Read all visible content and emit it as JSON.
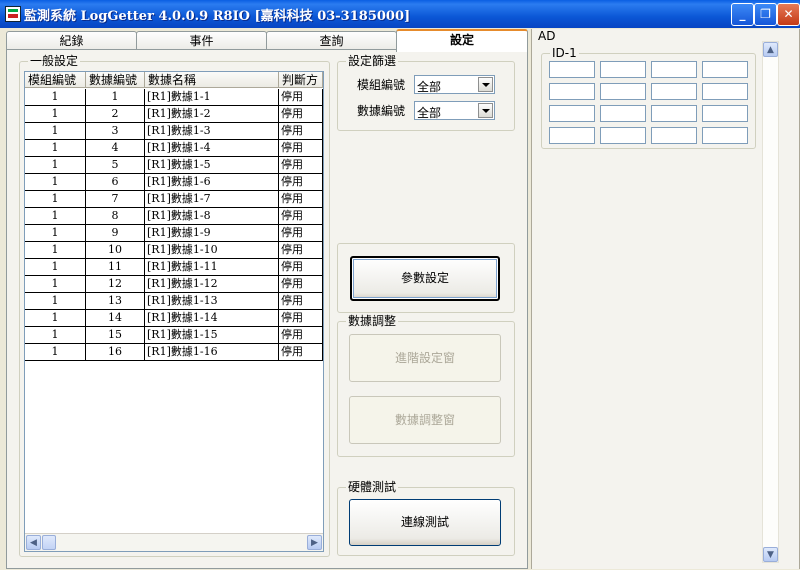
{
  "window": {
    "title": "監測系統 LogGetter 4.0.0.9 R8IO  [嘉科科技 03-3185000]",
    "minimize": "_",
    "maximize": "❐",
    "close": "✕"
  },
  "tabs": [
    {
      "label": "紀錄"
    },
    {
      "label": "事件"
    },
    {
      "label": "查詢"
    },
    {
      "label": "設定",
      "active": true
    }
  ],
  "general": {
    "group_label": "一般設定",
    "columns": [
      "模組編號",
      "數據編號",
      "數據名稱",
      "判斷方"
    ],
    "rows": [
      {
        "module": "1",
        "data_no": "1",
        "name": "[R1]數據1-1",
        "judge": "停用"
      },
      {
        "module": "1",
        "data_no": "2",
        "name": "[R1]數據1-2",
        "judge": "停用"
      },
      {
        "module": "1",
        "data_no": "3",
        "name": "[R1]數據1-3",
        "judge": "停用"
      },
      {
        "module": "1",
        "data_no": "4",
        "name": "[R1]數據1-4",
        "judge": "停用"
      },
      {
        "module": "1",
        "data_no": "5",
        "name": "[R1]數據1-5",
        "judge": "停用"
      },
      {
        "module": "1",
        "data_no": "6",
        "name": "[R1]數據1-6",
        "judge": "停用"
      },
      {
        "module": "1",
        "data_no": "7",
        "name": "[R1]數據1-7",
        "judge": "停用"
      },
      {
        "module": "1",
        "data_no": "8",
        "name": "[R1]數據1-8",
        "judge": "停用"
      },
      {
        "module": "1",
        "data_no": "9",
        "name": "[R1]數據1-9",
        "judge": "停用"
      },
      {
        "module": "1",
        "data_no": "10",
        "name": "[R1]數據1-10",
        "judge": "停用"
      },
      {
        "module": "1",
        "data_no": "11",
        "name": "[R1]數據1-11",
        "judge": "停用"
      },
      {
        "module": "1",
        "data_no": "12",
        "name": "[R1]數據1-12",
        "judge": "停用"
      },
      {
        "module": "1",
        "data_no": "13",
        "name": "[R1]數據1-13",
        "judge": "停用"
      },
      {
        "module": "1",
        "data_no": "14",
        "name": "[R1]數據1-14",
        "judge": "停用"
      },
      {
        "module": "1",
        "data_no": "15",
        "name": "[R1]數據1-15",
        "judge": "停用"
      },
      {
        "module": "1",
        "data_no": "16",
        "name": "[R1]數據1-16",
        "judge": "停用"
      }
    ],
    "scroll_left": "◀",
    "scroll_right": "▶"
  },
  "filter": {
    "group_label": "設定篩選",
    "module_label": "模組編號",
    "module_value": "全部",
    "data_label": "數據編號",
    "data_value": "全部"
  },
  "param_button": "參數設定",
  "adjust": {
    "group_label": "數據調整",
    "advanced_button": "進階設定窗",
    "adjust_button": "數據調整窗"
  },
  "hardware": {
    "group_label": "硬體測試",
    "connection_button": "連線測試"
  },
  "ad": {
    "panel_label": "AD",
    "group_label": "ID-1",
    "cells": [
      "",
      "",
      "",
      "",
      "",
      "",
      "",
      "",
      "",
      "",
      "",
      "",
      "",
      "",
      "",
      ""
    ],
    "scroll_up": "▲",
    "scroll_down": "▼"
  }
}
